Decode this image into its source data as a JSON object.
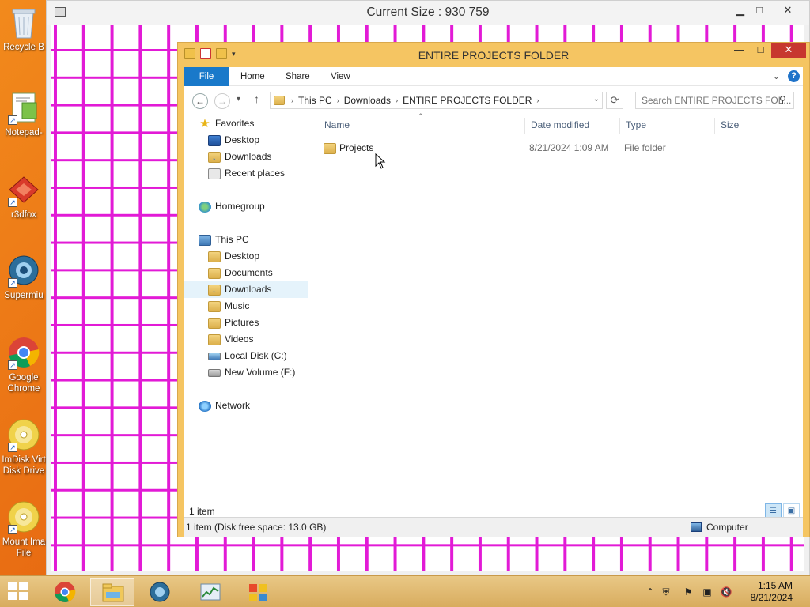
{
  "desktop": {
    "icons": [
      {
        "label": "Recycle B",
        "icon": "recycle-bin-icon"
      },
      {
        "label": "Notepad-",
        "icon": "notepad-icon"
      },
      {
        "label": "r3dfox",
        "icon": "r3dfox-icon"
      },
      {
        "label": "Supermiu",
        "icon": "supermium-icon"
      },
      {
        "label": "Google Chrome",
        "icon": "chrome-icon"
      },
      {
        "label": "ImDisk Virt Disk Drive",
        "icon": "imdisk-icon"
      },
      {
        "label": "Mount Ima File",
        "icon": "mount-image-icon"
      }
    ]
  },
  "bg_window": {
    "title": "Current Size :  930 759",
    "min": "▁",
    "max": "□",
    "close": "✕"
  },
  "explorer": {
    "title": "ENTIRE PROJECTS FOLDER",
    "controls": {
      "min": "—",
      "max": "□",
      "close": "✕"
    },
    "ribbon": {
      "tabs": [
        "File",
        "Home",
        "Share",
        "View"
      ]
    },
    "address": {
      "crumbs": [
        "This PC",
        "Downloads",
        "ENTIRE PROJECTS FOLDER"
      ],
      "search_placeholder": "Search ENTIRE PROJECTS FOL..."
    },
    "nav": {
      "favorites": "Favorites",
      "fav_items": [
        "Desktop",
        "Downloads",
        "Recent places"
      ],
      "homegroup": "Homegroup",
      "this_pc": "This PC",
      "pc_items": [
        "Desktop",
        "Documents",
        "Downloads",
        "Music",
        "Pictures",
        "Videos",
        "Local Disk (C:)",
        "New Volume (F:)"
      ],
      "network": "Network",
      "selected": "Downloads"
    },
    "columns": {
      "name": "Name",
      "date": "Date modified",
      "type": "Type",
      "size": "Size"
    },
    "files": [
      {
        "name": "Projects",
        "date": "8/21/2024 1:09 AM",
        "type": "File folder",
        "size": ""
      }
    ],
    "item_count": "1 item",
    "status": {
      "left": "1 item (Disk free space: 13.0 GB)",
      "location": "Computer"
    }
  },
  "taskbar": {
    "apps": [
      "chrome",
      "file-explorer",
      "supermium",
      "task-manager",
      "control-panel"
    ],
    "active_app": "file-explorer",
    "time": "1:15 AM",
    "date": "8/21/2024"
  },
  "colors": {
    "accent_blue": "#1979ca",
    "grid_magenta": "#e21ad6",
    "window_frame": "#f5c562",
    "close_red": "#c7372f"
  }
}
